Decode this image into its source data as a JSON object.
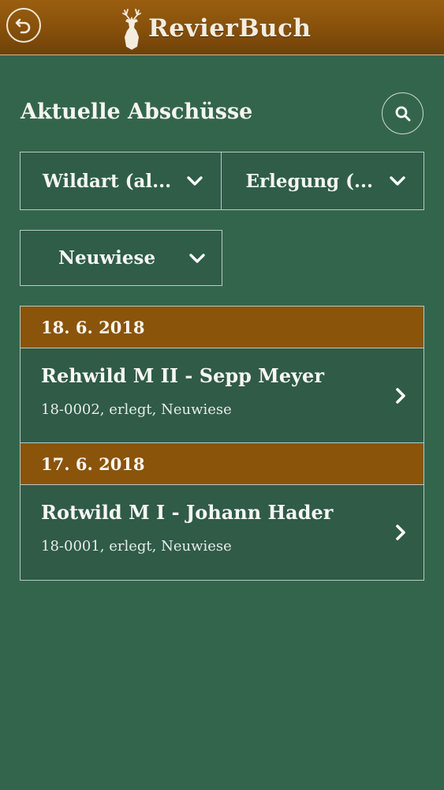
{
  "header": {
    "app_name": "RevierBuch",
    "back_icon": "back-arrow-icon",
    "logo_icon": "deer-icon"
  },
  "page": {
    "title": "Aktuelle Abschüsse",
    "search_icon": "search-icon"
  },
  "filters": {
    "wildart": "Wildart (al...",
    "erlegung": "Erlegung (...",
    "revier": "Neuwiese"
  },
  "groups": [
    {
      "date": "18. 6. 2018",
      "entries": [
        {
          "title": "Rehwild M II - Sepp Meyer",
          "subtitle": "18-0002, erlegt, Neuwiese"
        }
      ]
    },
    {
      "date": "17. 6. 2018",
      "entries": [
        {
          "title": "Rotwild M I - Johann Hader",
          "subtitle": "18-0001, erlegt, Neuwiese"
        }
      ]
    }
  ],
  "colors": {
    "background": "#33654d",
    "header_brown": "#86500b",
    "date_header": "#8a540a",
    "border": "#b9c9bf"
  }
}
